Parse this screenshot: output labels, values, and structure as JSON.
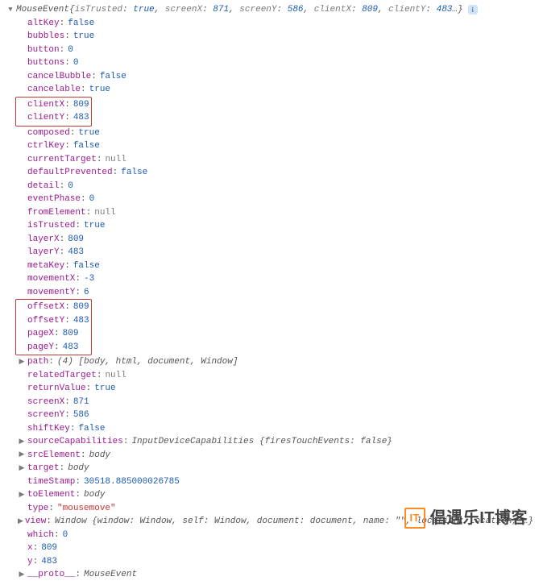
{
  "object": {
    "constructor": "MouseEvent",
    "preview": [
      {
        "k": "isTrusted",
        "v": "true",
        "t": "bool"
      },
      {
        "k": "screenX",
        "v": "871",
        "t": "num"
      },
      {
        "k": "screenY",
        "v": "586",
        "t": "num"
      },
      {
        "k": "clientX",
        "v": "809",
        "t": "num"
      },
      {
        "k": "clientY",
        "v": "483",
        "t": "num"
      },
      {
        "k": "",
        "v": "…",
        "t": "ellipsis"
      }
    ],
    "props": [
      {
        "key": "altKey",
        "value": "false",
        "t": "bool",
        "box": 0
      },
      {
        "key": "bubbles",
        "value": "true",
        "t": "bool",
        "box": 0
      },
      {
        "key": "button",
        "value": "0",
        "t": "num",
        "box": 0
      },
      {
        "key": "buttons",
        "value": "0",
        "t": "num",
        "box": 0
      },
      {
        "key": "cancelBubble",
        "value": "false",
        "t": "bool",
        "box": 0
      },
      {
        "key": "cancelable",
        "value": "true",
        "t": "bool",
        "box": 0
      },
      {
        "key": "clientX",
        "value": "809",
        "t": "num",
        "box": 1
      },
      {
        "key": "clientY",
        "value": "483",
        "t": "num",
        "box": 1
      },
      {
        "key": "composed",
        "value": "true",
        "t": "bool",
        "box": 0
      },
      {
        "key": "ctrlKey",
        "value": "false",
        "t": "bool",
        "box": 0
      },
      {
        "key": "currentTarget",
        "value": "null",
        "t": "null",
        "box": 0
      },
      {
        "key": "defaultPrevented",
        "value": "false",
        "t": "bool",
        "box": 0
      },
      {
        "key": "detail",
        "value": "0",
        "t": "num",
        "box": 0
      },
      {
        "key": "eventPhase",
        "value": "0",
        "t": "num",
        "box": 0
      },
      {
        "key": "fromElement",
        "value": "null",
        "t": "null",
        "box": 0
      },
      {
        "key": "isTrusted",
        "value": "true",
        "t": "bool",
        "box": 0
      },
      {
        "key": "layerX",
        "value": "809",
        "t": "num",
        "box": 0
      },
      {
        "key": "layerY",
        "value": "483",
        "t": "num",
        "box": 0
      },
      {
        "key": "metaKey",
        "value": "false",
        "t": "bool",
        "box": 0
      },
      {
        "key": "movementX",
        "value": "-3",
        "t": "num",
        "box": 0
      },
      {
        "key": "movementY",
        "value": "6",
        "t": "num",
        "box": 0
      },
      {
        "key": "offsetX",
        "value": "809",
        "t": "num",
        "box": 2
      },
      {
        "key": "offsetY",
        "value": "483",
        "t": "num",
        "box": 2
      },
      {
        "key": "pageX",
        "value": "809",
        "t": "num",
        "box": 2
      },
      {
        "key": "pageY",
        "value": "483",
        "t": "num",
        "box": 2
      },
      {
        "key": "path",
        "expandable": true,
        "summary": "(4) [body, html, document, Window]",
        "t": "summary"
      },
      {
        "key": "relatedTarget",
        "value": "null",
        "t": "null",
        "box": 0
      },
      {
        "key": "returnValue",
        "value": "true",
        "t": "bool",
        "box": 0
      },
      {
        "key": "screenX",
        "value": "871",
        "t": "num",
        "box": 0
      },
      {
        "key": "screenY",
        "value": "586",
        "t": "num",
        "box": 0
      },
      {
        "key": "shiftKey",
        "value": "false",
        "t": "bool",
        "box": 0
      },
      {
        "key": "sourceCapabilities",
        "expandable": true,
        "summary": "InputDeviceCapabilities {firesTouchEvents: false}",
        "t": "summary"
      },
      {
        "key": "srcElement",
        "expandable": true,
        "summary": "body",
        "t": "summary"
      },
      {
        "key": "target",
        "expandable": true,
        "summary": "body",
        "t": "summary"
      },
      {
        "key": "timeStamp",
        "value": "30518.885000026785",
        "t": "num",
        "box": 0
      },
      {
        "key": "toElement",
        "expandable": true,
        "summary": "body",
        "t": "summary"
      },
      {
        "key": "type",
        "value": "\"mousemove\"",
        "t": "str",
        "box": 0
      },
      {
        "key": "view",
        "expandable": true,
        "summary": "Window {window: Window, self: Window, document: document, name: \"\", location: Location, …}",
        "t": "summary"
      },
      {
        "key": "which",
        "value": "0",
        "t": "num",
        "box": 0
      },
      {
        "key": "x",
        "value": "809",
        "t": "num",
        "box": 0
      },
      {
        "key": "y",
        "value": "483",
        "t": "num",
        "box": 0
      },
      {
        "key": "__proto__",
        "expandable": true,
        "summary": "MouseEvent",
        "t": "summary"
      }
    ]
  },
  "footer": {
    "logo": "IT",
    "text": "倡遇乐IT博客"
  }
}
